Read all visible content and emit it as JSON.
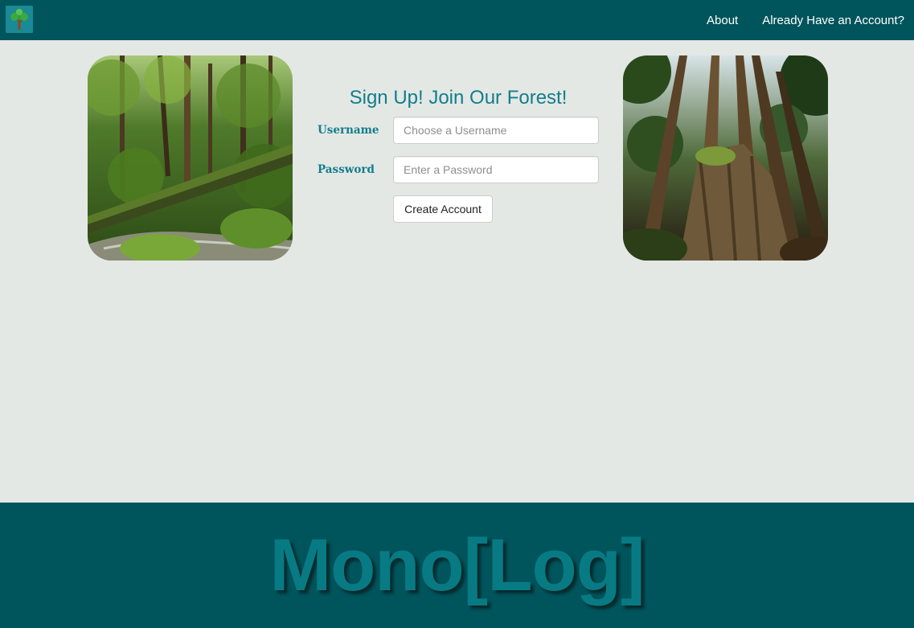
{
  "navbar": {
    "logo_icon": "tree-icon",
    "links": [
      {
        "label": "About"
      },
      {
        "label": "Already Have an Account?"
      }
    ]
  },
  "photos": {
    "left_icon": "forest-stream-photo",
    "right_icon": "redwood-stump-photo"
  },
  "form": {
    "title": "Sign Up! Join Our Forest!",
    "username_label": "Username",
    "username_placeholder": "Choose a Username",
    "username_value": "",
    "password_label": "Password",
    "password_placeholder": "Enter a Password",
    "password_value": "",
    "submit_label": "Create Account"
  },
  "footer": {
    "brand": "Mono[Log]"
  },
  "colors": {
    "navbar_bg": "#00545c",
    "page_bg": "#e3e8e5",
    "accent_teal": "#137d8a",
    "footer_text": "#087a84"
  }
}
